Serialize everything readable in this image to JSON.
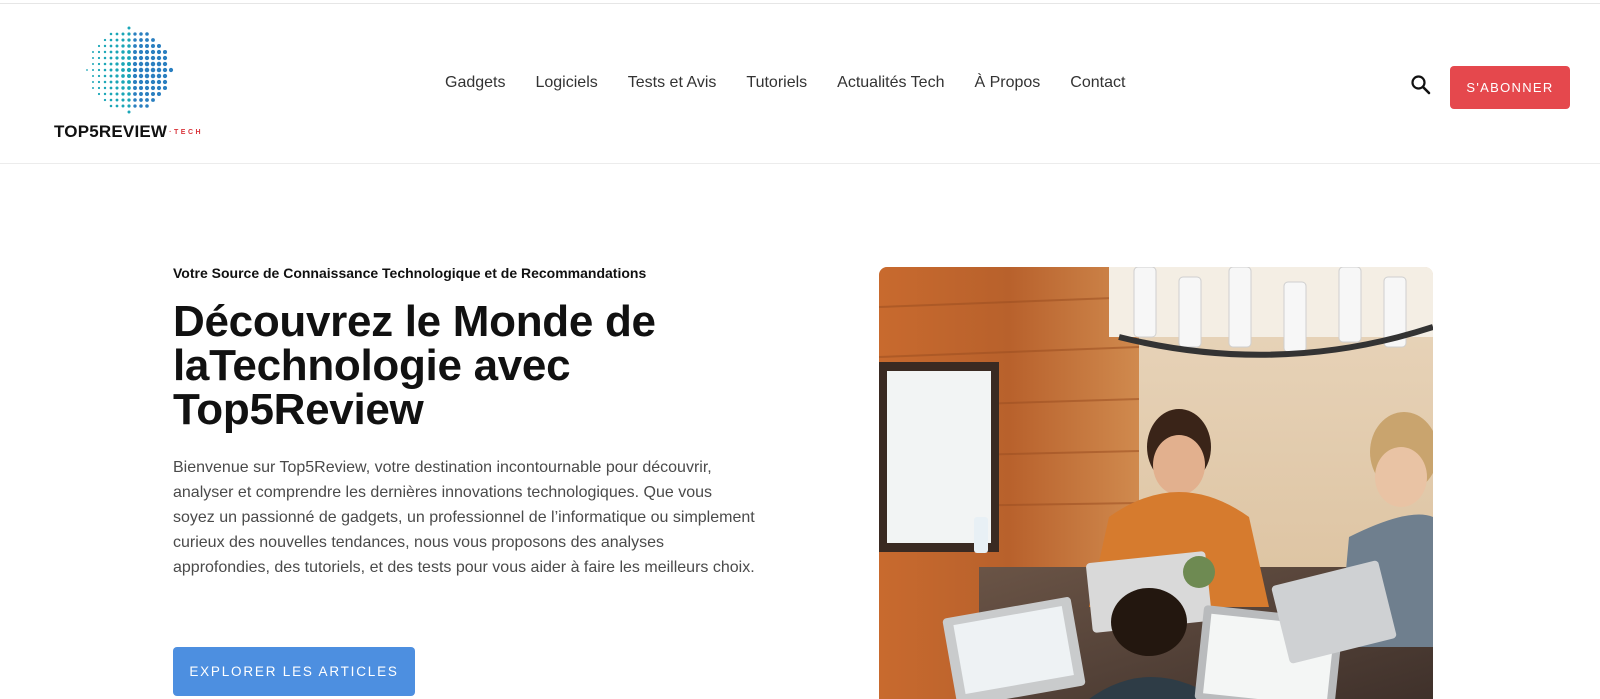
{
  "brand": {
    "name": "TOP5REVIEW",
    "suffix": "TECH",
    "accent_color": "#e5484d",
    "logo_globe_colors": [
      "#1aa6b7",
      "#2a7fc0"
    ]
  },
  "nav": {
    "items": [
      {
        "label": "Gadgets"
      },
      {
        "label": "Logiciels"
      },
      {
        "label": "Tests et Avis"
      },
      {
        "label": "Tutoriels"
      },
      {
        "label": "Actualités Tech"
      },
      {
        "label": "À Propos"
      },
      {
        "label": "Contact"
      }
    ],
    "search_icon": "search-icon",
    "subscribe_label": "S'ABONNER"
  },
  "hero": {
    "eyebrow": "Votre Source de Connaissance Technologique et de Recommandations",
    "title_line1": "Découvrez le Monde de",
    "title_line2": "laTechnologie avec",
    "title_line3": "Top5Review",
    "description": "Bienvenue sur Top5Review, votre destination incontournable pour découvrir, analyser et comprendre les dernières innovations technologiques. Que vous soyez un passionné de gadgets, un professionnel de l’informatique ou simplement curieux des nouvelles tendances, nous vous proposons des analyses approfondies, des tutoriels, et des tests pour vous aider à faire les meilleurs choix.",
    "cta_label": "EXPLORER LES ARTICLES",
    "cta_color": "#4d8fe0"
  }
}
